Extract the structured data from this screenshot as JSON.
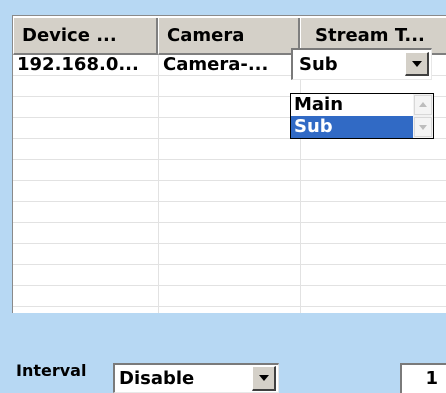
{
  "grid": {
    "columns": [
      "Device ...",
      "Camera",
      "Stream T..."
    ],
    "rows": [
      {
        "device": "192.168.0...",
        "camera": "Camera-...",
        "stream": "Sub"
      }
    ]
  },
  "stream_dropdown": {
    "options": [
      "Main",
      "Sub"
    ],
    "selected": "Sub"
  },
  "footer": {
    "interval_label": "Interval",
    "interval_value": "Disable",
    "page_value": "1"
  },
  "colors": {
    "background": "#b7d8f3",
    "selection": "#316ac5",
    "header": "#d4d0c8"
  }
}
